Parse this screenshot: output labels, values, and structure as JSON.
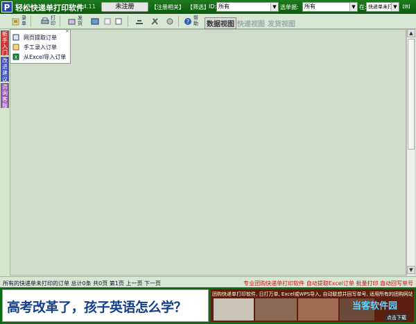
{
  "app": {
    "logo_letter": "P",
    "title": "轻松快递单打印软件",
    "version": "V 4.11",
    "unregistered": "未注册"
  },
  "header": {
    "register_link": "【注册相关】",
    "filter_link": "【筛选】",
    "id_label": "ID:",
    "id_value": "所有",
    "waybill_label": "选单据:",
    "waybill_value": "所有",
    "in_label": "在:",
    "in_value": "快递单未打",
    "filter2_link": "【筛】",
    "all_link": "【所有】"
  },
  "toolbar": {
    "buttons": [
      {
        "label": "录单",
        "icon": "record-order-icon"
      },
      {
        "label": "打印",
        "icon": "print-icon"
      },
      {
        "label": "发货",
        "icon": "ship-icon"
      },
      {
        "label": "表格",
        "icon": "table-icon"
      },
      {
        "label": "删除",
        "icon": "delete-icon"
      },
      {
        "label": "修改",
        "icon": "edit-icon"
      },
      {
        "label": "单设",
        "icon": "template-icon"
      },
      {
        "label": "工具",
        "icon": "tools-icon"
      },
      {
        "label": "设置",
        "icon": "settings-icon"
      },
      {
        "label": "帮助",
        "icon": "help-icon"
      }
    ],
    "views": [
      "数据视图",
      "快递视图",
      "发货视图"
    ]
  },
  "sidetabs": [
    "新手入门",
    "改进建议",
    "咨询客服"
  ],
  "import_menu": {
    "items": [
      {
        "label": "网页提取订单",
        "icon": "web-icon"
      },
      {
        "label": "手工录入订单",
        "icon": "manual-entry-icon"
      },
      {
        "label": "从Excel导入订单",
        "icon": "excel-icon"
      }
    ],
    "close": "×"
  },
  "status": {
    "left": "所有的快递单未打印的订单  总计0条 共0页 第1页    上一页 下一页",
    "right": "专业团购快递单打印软件 自动提取Excel订单 批量打印 自动回写单号"
  },
  "ad": {
    "left_text": "高考改革了，孩子英语怎么学？",
    "right_text": "团购快递单打印软件, 日打万单, Excel或WPS导入, 自动联想并回写单号, 适用所有的团购网站",
    "watermark": "当客软件园",
    "more": "点击下载"
  },
  "colors": {
    "titlebar": "#0c5a0c",
    "accent_red": "#d01010",
    "ad_blue": "#123e8a"
  }
}
